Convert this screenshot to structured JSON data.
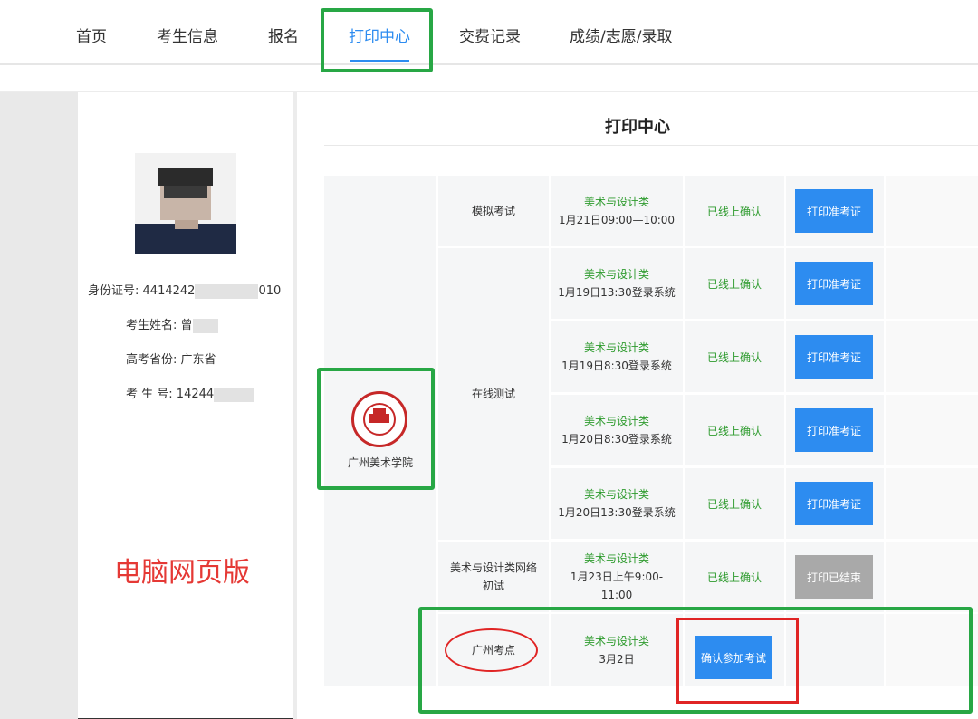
{
  "nav": {
    "items": [
      "首页",
      "考生信息",
      "报名",
      "打印中心",
      "交费记录",
      "成绩/志愿/录取"
    ],
    "active_index": 3
  },
  "profile": {
    "id_label": "身份证号:",
    "id_prefix": "4414242",
    "id_suffix": "010",
    "name_label": "考生姓名:",
    "name_value": "曾",
    "province_label": "高考省份:",
    "province_value": "广东省",
    "exam_no_label": "考 生 号:",
    "exam_no_value": "14244"
  },
  "watermark": "电脑网页版",
  "main": {
    "title": "打印中心",
    "college_name": "广州美术学院",
    "exams": [
      {
        "type": "模拟考试",
        "category": "美术与设计类",
        "time": "1月21日09:00—10:00",
        "status": "已线上确认",
        "button": "打印准考证",
        "button_state": "active"
      },
      {
        "type": "在线测试",
        "category": "美术与设计类",
        "time": "1月19日13:30登录系统",
        "status": "已线上确认",
        "button": "打印准考证",
        "button_state": "active"
      },
      {
        "type": "在线测试",
        "category": "美术与设计类",
        "time": "1月19日8:30登录系统",
        "status": "已线上确认",
        "button": "打印准考证",
        "button_state": "active"
      },
      {
        "type": "在线测试",
        "category": "美术与设计类",
        "time": "1月20日8:30登录系统",
        "status": "已线上确认",
        "button": "打印准考证",
        "button_state": "active"
      },
      {
        "type": "在线测试",
        "category": "美术与设计类",
        "time": "1月20日13:30登录系统",
        "status": "已线上确认",
        "button": "打印准考证",
        "button_state": "active"
      },
      {
        "type": "美术与设计类网络初试",
        "category": "美术与设计类",
        "time": "1月23日上午9:00-11:00",
        "status": "已线上确认",
        "button": "打印已结束",
        "button_state": "disabled"
      },
      {
        "type": "广州考点",
        "category": "美术与设计类",
        "time": "3月2日",
        "status": "",
        "button": "确认参加考试",
        "button_state": "active"
      }
    ]
  },
  "colors": {
    "accent_blue": "#2d8cf0",
    "status_green": "#2e9b2e",
    "annotation_green": "#28a745",
    "annotation_red": "#e02424"
  }
}
